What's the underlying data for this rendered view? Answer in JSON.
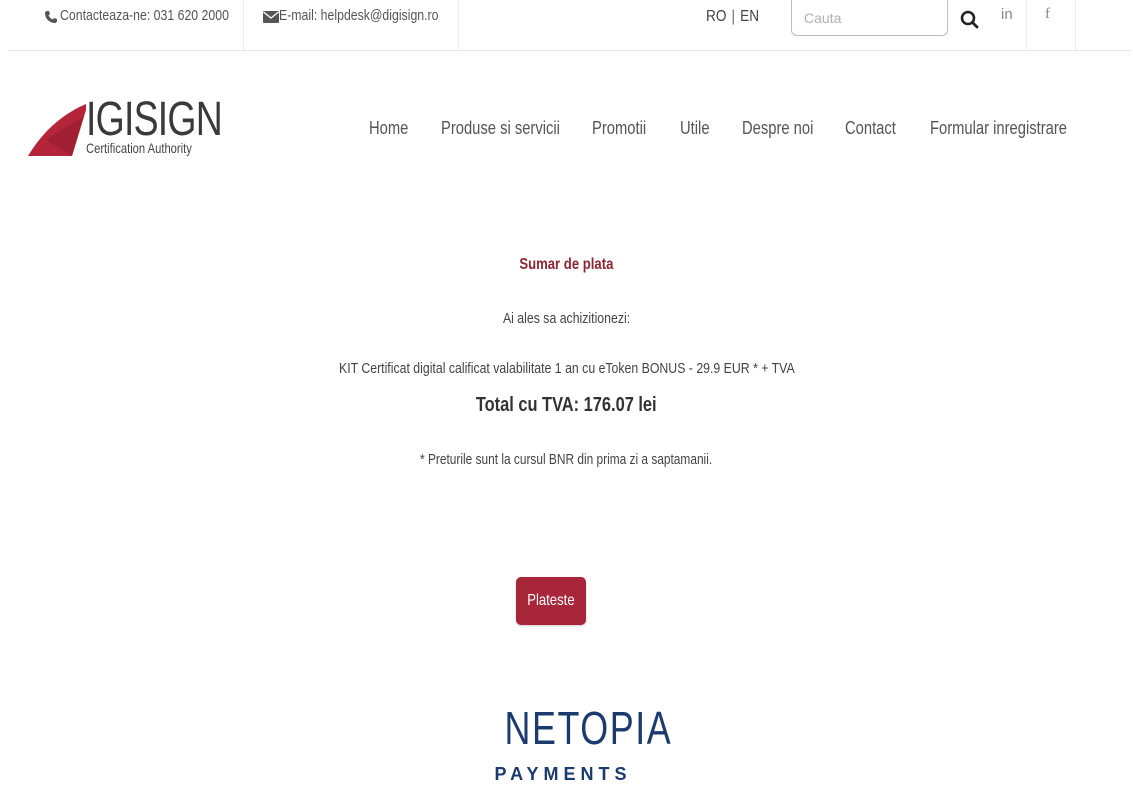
{
  "topbar": {
    "phone": "Contacteaza-ne: 031 620 2000",
    "email": "E-mail: helpdesk@digisign.ro",
    "lang_ro": "RO",
    "lang_sep": "|",
    "lang_en": "EN",
    "search_placeholder": "Cauta",
    "social_linkedin": "in",
    "social_facebook": "f"
  },
  "header": {
    "logo_text": "IGISIGN",
    "logo_sub": "Certification Authority",
    "nav": [
      "Home",
      "Produse si servicii",
      "Promotii",
      "Utile",
      "Despre noi",
      "Contact",
      "Formular inregistrare"
    ]
  },
  "summary": {
    "title": "Sumar de plata",
    "intro": "Ai ales sa achizitionezi:",
    "product": "KIT Certificat digital calificat valabilitate 1 an cu eToken BONUS - 29.9 EUR * + TVA",
    "total": "Total cu TVA: 176.07 lei",
    "note": "* Preturile sunt la cursul BNR din prima zi a saptamanii."
  },
  "pay_button": "Plateste",
  "netopia": {
    "brand": "NETOPIA",
    "sub": "PAYMENTS"
  },
  "colors": {
    "accent": "#a8263a",
    "title": "#8b2632",
    "netopia": "#1b3a6e",
    "logo_red": "#b5253a"
  }
}
